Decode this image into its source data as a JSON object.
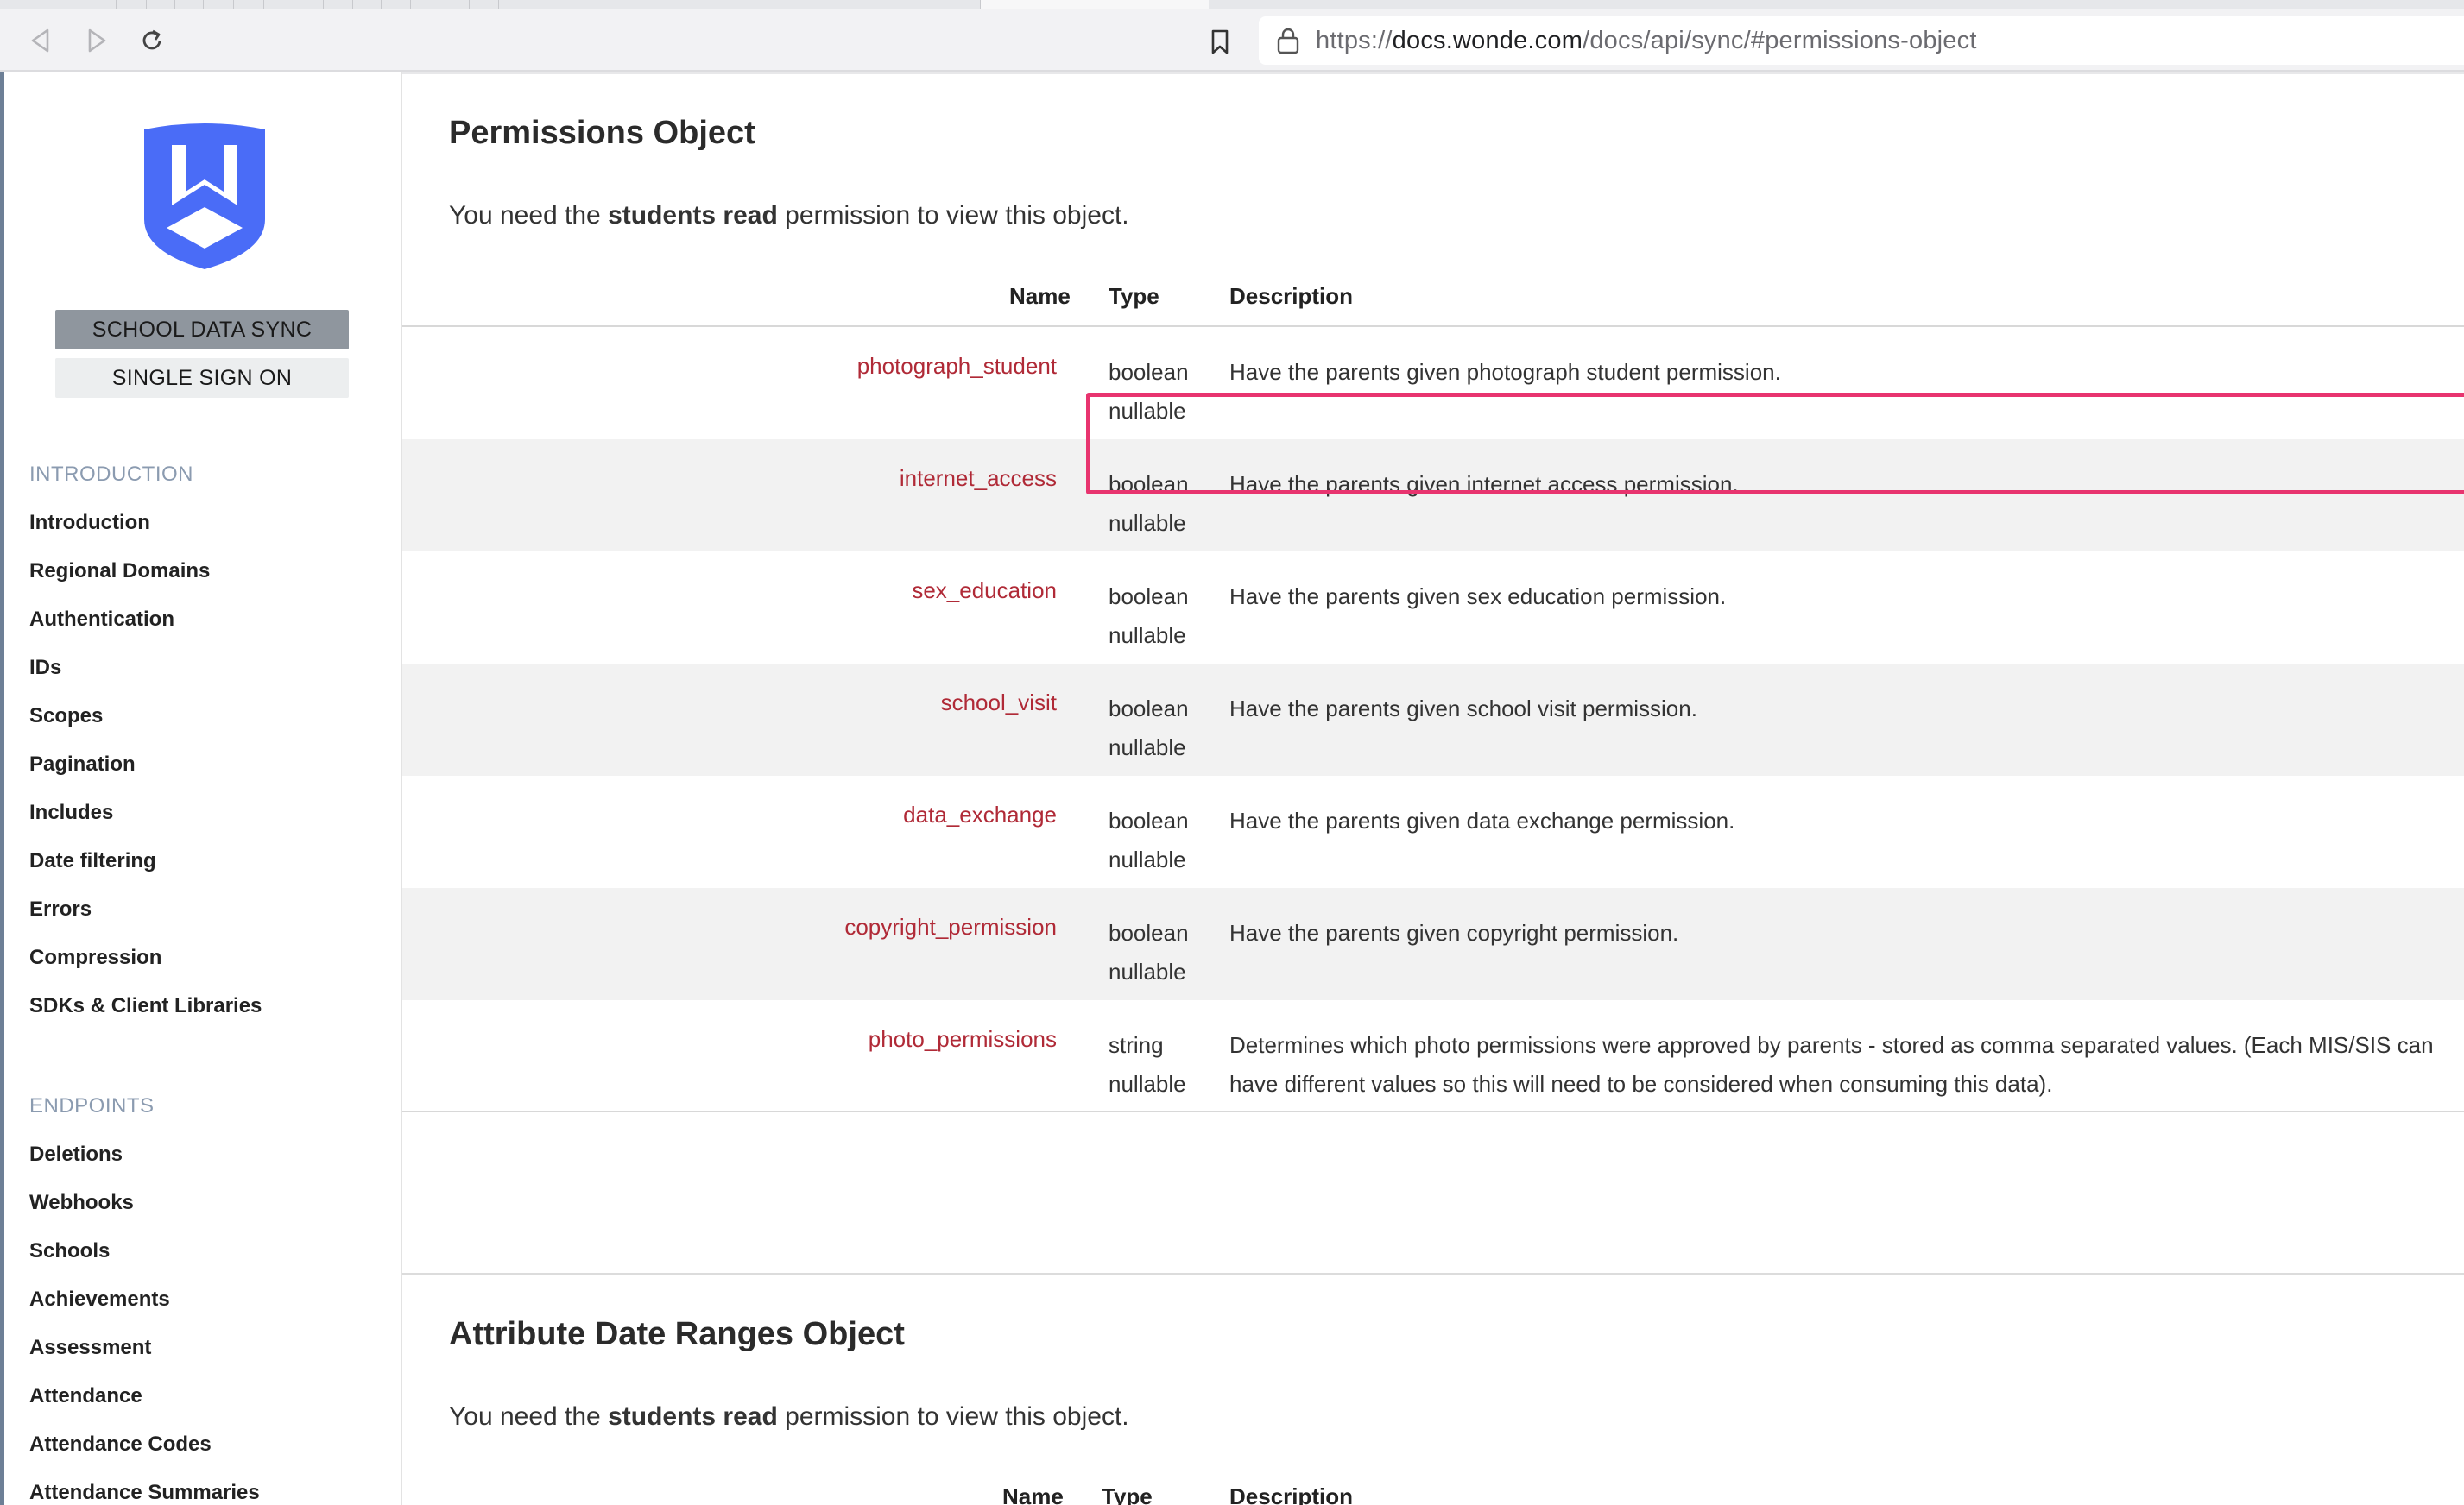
{
  "browser": {
    "url_prefix": "https://",
    "url_domain": "docs.wonde.com",
    "url_path": "/docs/api/sync/#permissions-object"
  },
  "sidebar": {
    "product_buttons": [
      "SCHOOL DATA SYNC",
      "SINGLE SIGN ON"
    ],
    "sections": [
      {
        "heading": "INTRODUCTION",
        "items": [
          "Introduction",
          "Regional Domains",
          "Authentication",
          "IDs",
          "Scopes",
          "Pagination",
          "Includes",
          "Date filtering",
          "Errors",
          "Compression",
          "SDKs & Client Libraries"
        ]
      },
      {
        "heading": "ENDPOINTS",
        "items": [
          "Deletions",
          "Webhooks",
          "Schools",
          "Achievements",
          "Assessment",
          "Attendance",
          "Attendance Codes",
          "Attendance Summaries"
        ]
      }
    ]
  },
  "permissions_section": {
    "title": "Permissions Object",
    "intro_prefix": "You need the ",
    "intro_bold": "students read",
    "intro_suffix": " permission to view this object.",
    "headers": {
      "name": "Name",
      "type": "Type",
      "description": "Description"
    },
    "rows": [
      {
        "name": "photograph_student",
        "type": "boolean",
        "nullable": "nullable",
        "description": "Have the parents given photograph student permission."
      },
      {
        "name": "internet_access",
        "type": "boolean",
        "nullable": "nullable",
        "description": "Have the parents given internet access permission."
      },
      {
        "name": "sex_education",
        "type": "boolean",
        "nullable": "nullable",
        "description": "Have the parents given sex education permission."
      },
      {
        "name": "school_visit",
        "type": "boolean",
        "nullable": "nullable",
        "description": "Have the parents given school visit permission."
      },
      {
        "name": "data_exchange",
        "type": "boolean",
        "nullable": "nullable",
        "description": "Have the parents given data exchange permission."
      },
      {
        "name": "copyright_permission",
        "type": "boolean",
        "nullable": "nullable",
        "description": "Have the parents given copyright permission."
      },
      {
        "name": "photo_permissions",
        "type": "string",
        "nullable": "nullable",
        "description": "Determines which photo permissions were approved by parents - stored as comma separated values. (Each MIS/SIS can have different values so this will need to be considered when consuming this data)."
      }
    ]
  },
  "date_ranges_section": {
    "title": "Attribute Date Ranges Object",
    "intro_prefix": "You need the ",
    "intro_bold": "students read",
    "intro_suffix": " permission to view this object.",
    "headers": {
      "name": "Name",
      "type": "Type",
      "description": "Description"
    }
  },
  "colors": {
    "accent_blue": "#4a6cf7",
    "field_name": "#b02a37",
    "highlight": "#e8346f"
  }
}
